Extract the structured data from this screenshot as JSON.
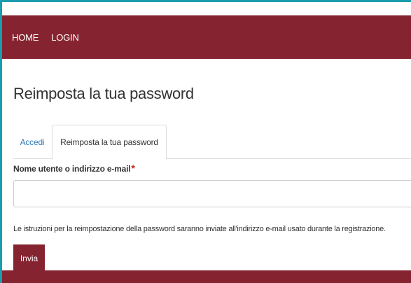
{
  "nav": {
    "items": [
      {
        "label": "HOME"
      },
      {
        "label": "LOGIN"
      }
    ]
  },
  "page": {
    "title": "Reimposta la tua password"
  },
  "tabs": [
    {
      "label": "Accedi",
      "active": false
    },
    {
      "label": "Reimposta la tua password",
      "active": true
    }
  ],
  "form": {
    "username_label": "Nome utente o indirizzo e-mail",
    "required_mark": "*",
    "username_value": "",
    "username_placeholder": "",
    "help_text": "Le istruzioni per la reimpostazione della password saranno inviate all'indirizzo e-mail usato durante la registrazione.",
    "submit_label": "Invia"
  },
  "colors": {
    "brand": "#852430",
    "link": "#337ab7",
    "required": "#c22525",
    "frame_accent": "#1a9dad"
  }
}
